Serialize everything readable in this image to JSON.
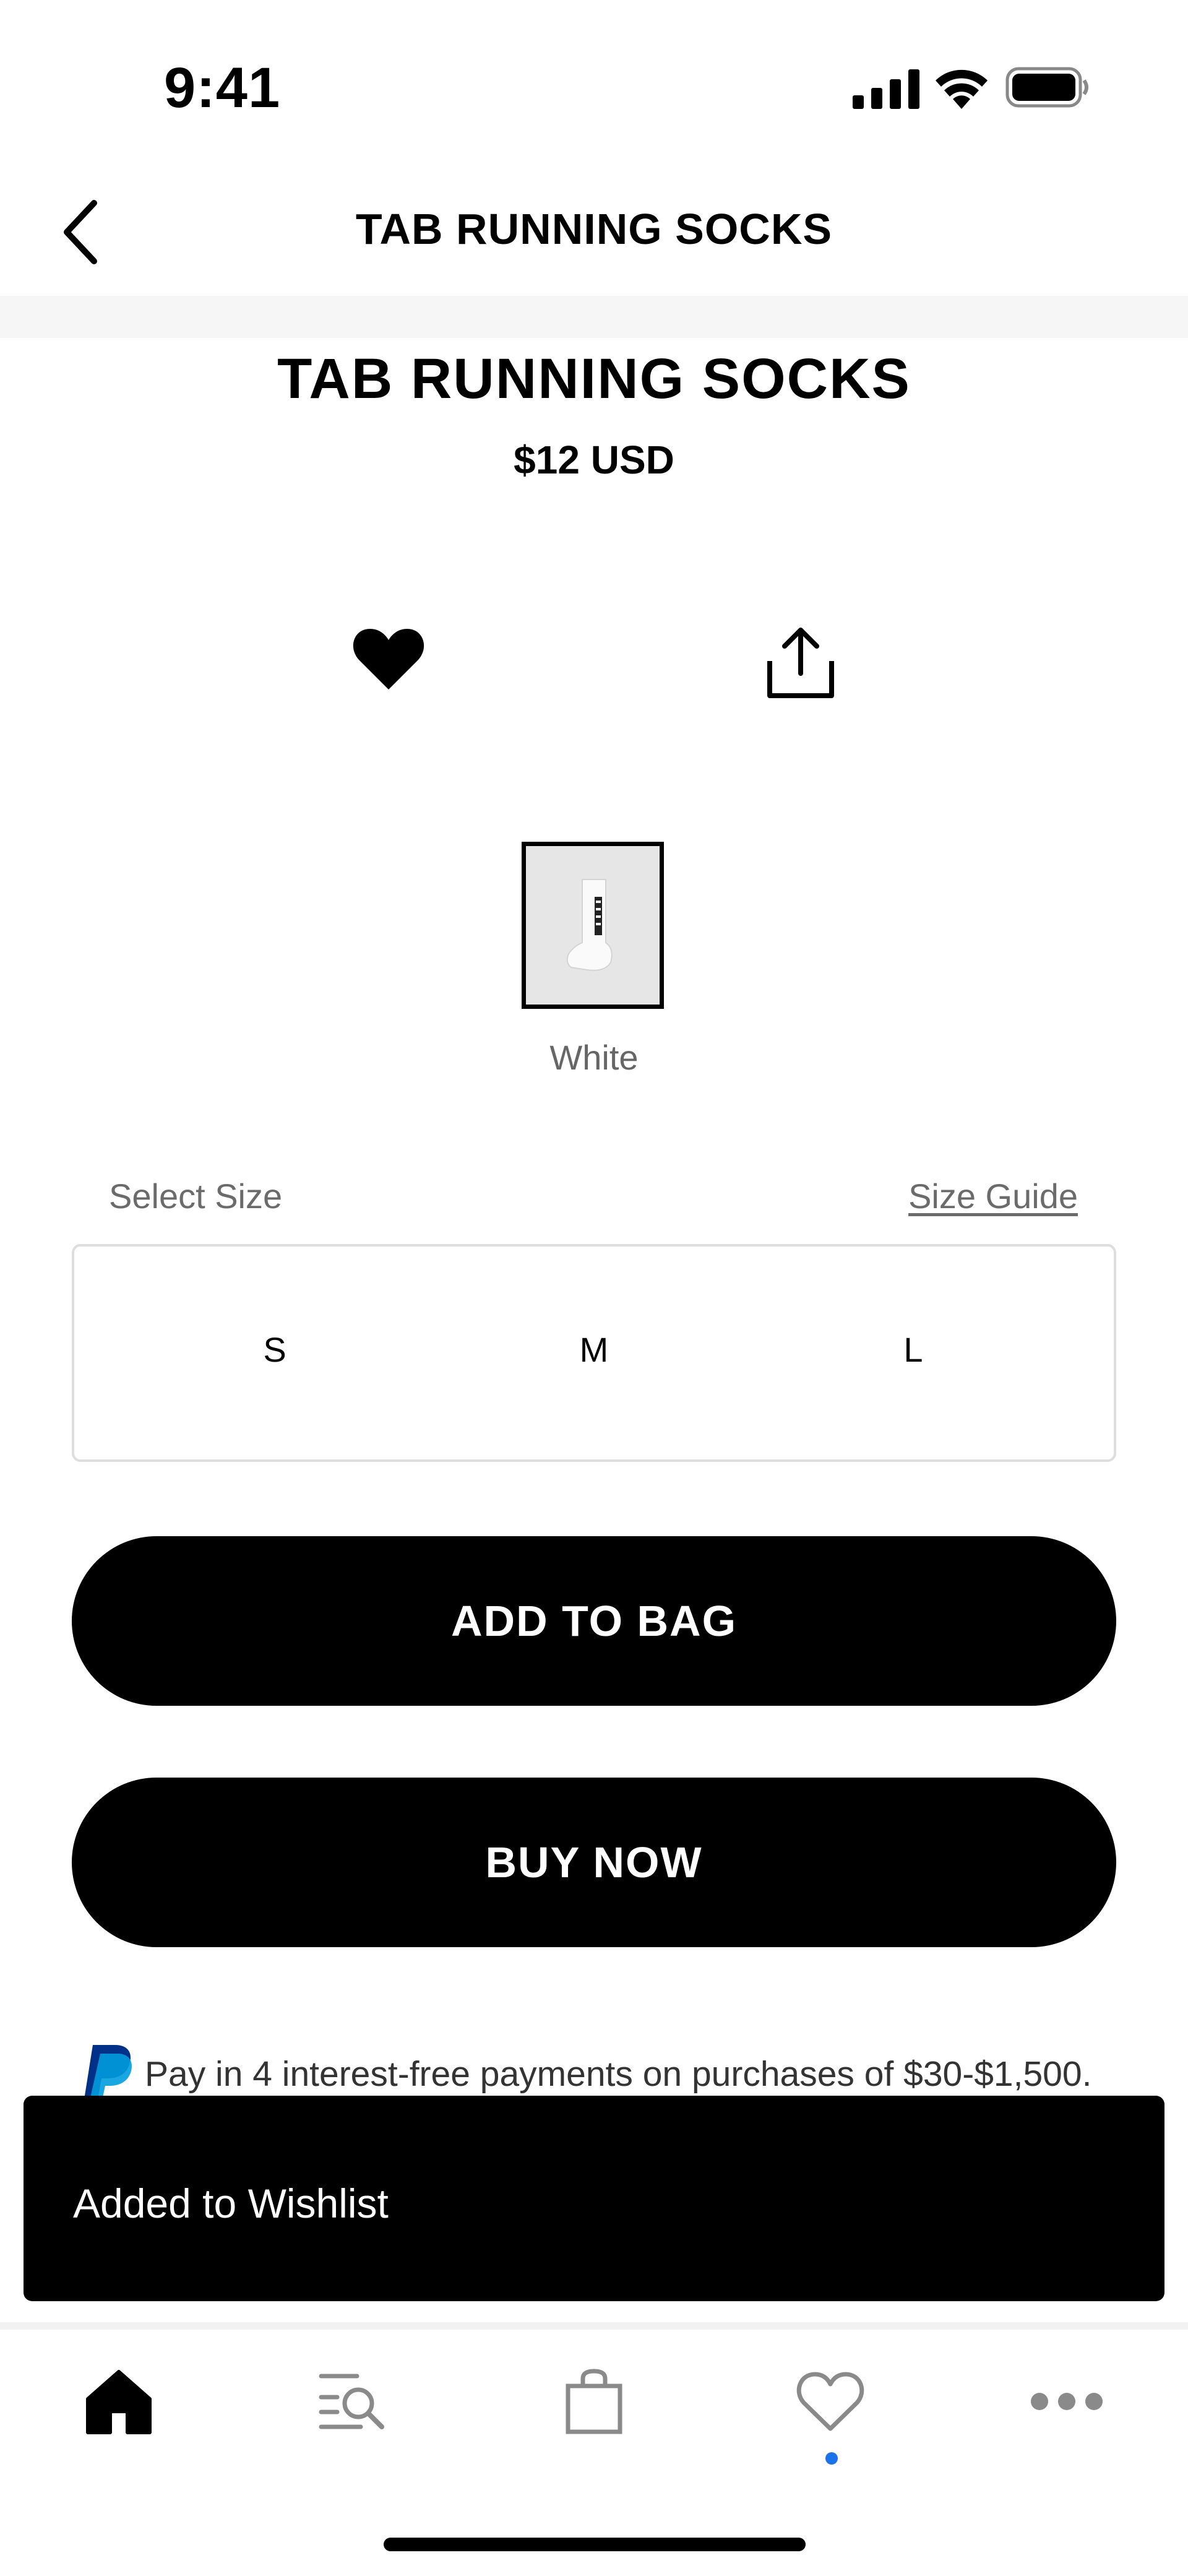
{
  "status_bar": {
    "time": "9:41",
    "icons": [
      "signal-icon",
      "wifi-icon",
      "battery-icon"
    ]
  },
  "nav": {
    "title": "TAB RUNNING SOCKS",
    "back_icon": "chevron-left-icon"
  },
  "product": {
    "title": "TAB RUNNING SOCKS",
    "price": "$12 USD",
    "actions": [
      "heart-icon",
      "share-icon"
    ]
  },
  "colors": {
    "selected": "White",
    "options": [
      {
        "label": "White"
      }
    ]
  },
  "sizes": {
    "label": "Select Size",
    "guide_link": "Size Guide",
    "options": [
      "S",
      "M",
      "L"
    ]
  },
  "buttons": {
    "add_to_bag": "ADD TO BAG",
    "buy_now": "BUY NOW"
  },
  "paypal": {
    "text": "Pay in 4 interest-free payments on purchases of $30-$1,500."
  },
  "toast": {
    "message": "Added to Wishlist"
  },
  "tab_bar": {
    "items": [
      "home-icon",
      "search-icon",
      "bag-icon",
      "wishlist-icon",
      "more-icon"
    ],
    "active_indicator_color": "#1a73e8"
  },
  "theme": {
    "accent": "#000000",
    "paypal_dark": "#003087",
    "paypal_light": "#009cde"
  }
}
